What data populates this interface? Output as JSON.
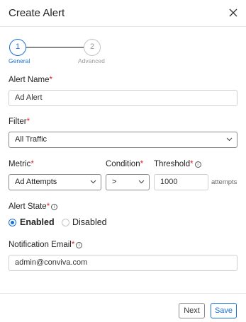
{
  "dialog": {
    "title": "Create Alert"
  },
  "stepper": {
    "steps": [
      {
        "number": "1",
        "label": "General"
      },
      {
        "number": "2",
        "label": "Advanced"
      }
    ]
  },
  "form": {
    "required_marker": "*",
    "info_glyph": "i",
    "alert_name": {
      "label": "Alert Name",
      "value": "Ad Alert"
    },
    "filter": {
      "label": "Filter",
      "value": "All Traffic"
    },
    "metric": {
      "label": "Metric",
      "value": "Ad Attempts"
    },
    "condition": {
      "label": "Condition",
      "value": ">"
    },
    "threshold": {
      "label": "Threshold",
      "value": "1000",
      "unit": "attempts"
    },
    "alert_state": {
      "label": "Alert State",
      "options": [
        "Enabled",
        "Disabled"
      ],
      "selected": "Enabled"
    },
    "notification_email": {
      "label": "Notification Email",
      "value": "admin@conviva.com"
    }
  },
  "footer": {
    "next_label": "Next",
    "save_label": "Save"
  },
  "colors": {
    "accent": "#1a6fd4",
    "required": "#d8242c",
    "border": "#cfcfcf"
  },
  "icons": {
    "close": "close-icon",
    "chevron": "chevron-down-icon",
    "info": "info-icon"
  }
}
